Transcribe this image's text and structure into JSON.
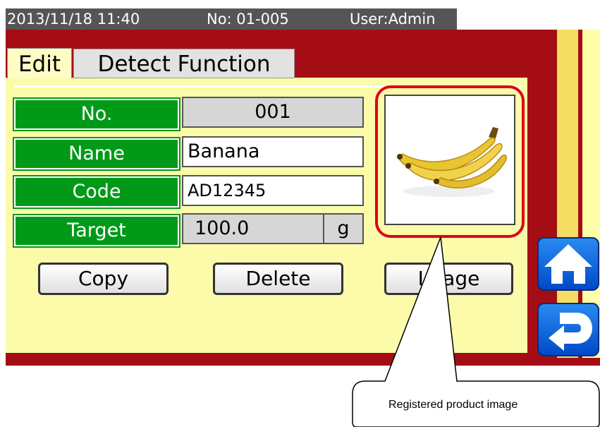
{
  "status": {
    "datetime": "2013/11/18  11:40",
    "number": "No: 01-005",
    "user": "User:Admin"
  },
  "tabs": {
    "edit": "Edit",
    "detect": "Detect Function"
  },
  "fields": {
    "no_label": "No.",
    "no_value": "001",
    "name_label": "Name",
    "name_value": "Banana",
    "code_label": "Code",
    "code_value": "AD12345",
    "target_label": "Target",
    "target_value": "100.0",
    "target_unit": "g"
  },
  "buttons": {
    "copy": "Copy",
    "delete": "Delete",
    "image": "Image"
  },
  "image": {
    "subject": "banana-photo"
  },
  "nav": {
    "home_icon": "home-icon",
    "back_icon": "return-icon"
  },
  "callout": {
    "text": "Registered product image"
  },
  "colors": {
    "panel_red": "#a50d15",
    "content_yellow": "#fbfbaa",
    "label_green": "#009a18",
    "nav_blue": "#1060e0",
    "highlight_red": "#e0001a"
  }
}
